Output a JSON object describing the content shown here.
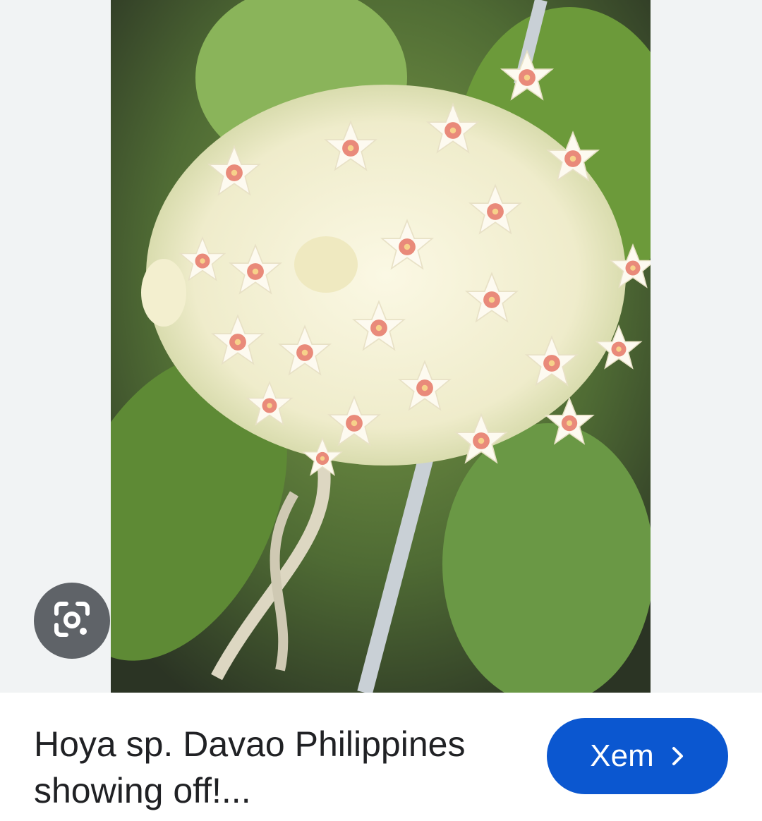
{
  "image": {
    "subject": "flower-cluster-photo",
    "colors": {
      "petal": "#f8f4dc",
      "center": "#e98a7a",
      "leaf": "#6c9a3a",
      "background": "#3a4a2e"
    }
  },
  "lens_button": {
    "icon": "google-lens-icon"
  },
  "result": {
    "title": "Hoya sp. Davao Philippines showing off!...",
    "visit_label": "Xem",
    "visit_icon": "chevron-right-icon"
  },
  "colors": {
    "accent": "#0b57d0",
    "lens_bg": "#5f6368",
    "text": "#202124"
  }
}
